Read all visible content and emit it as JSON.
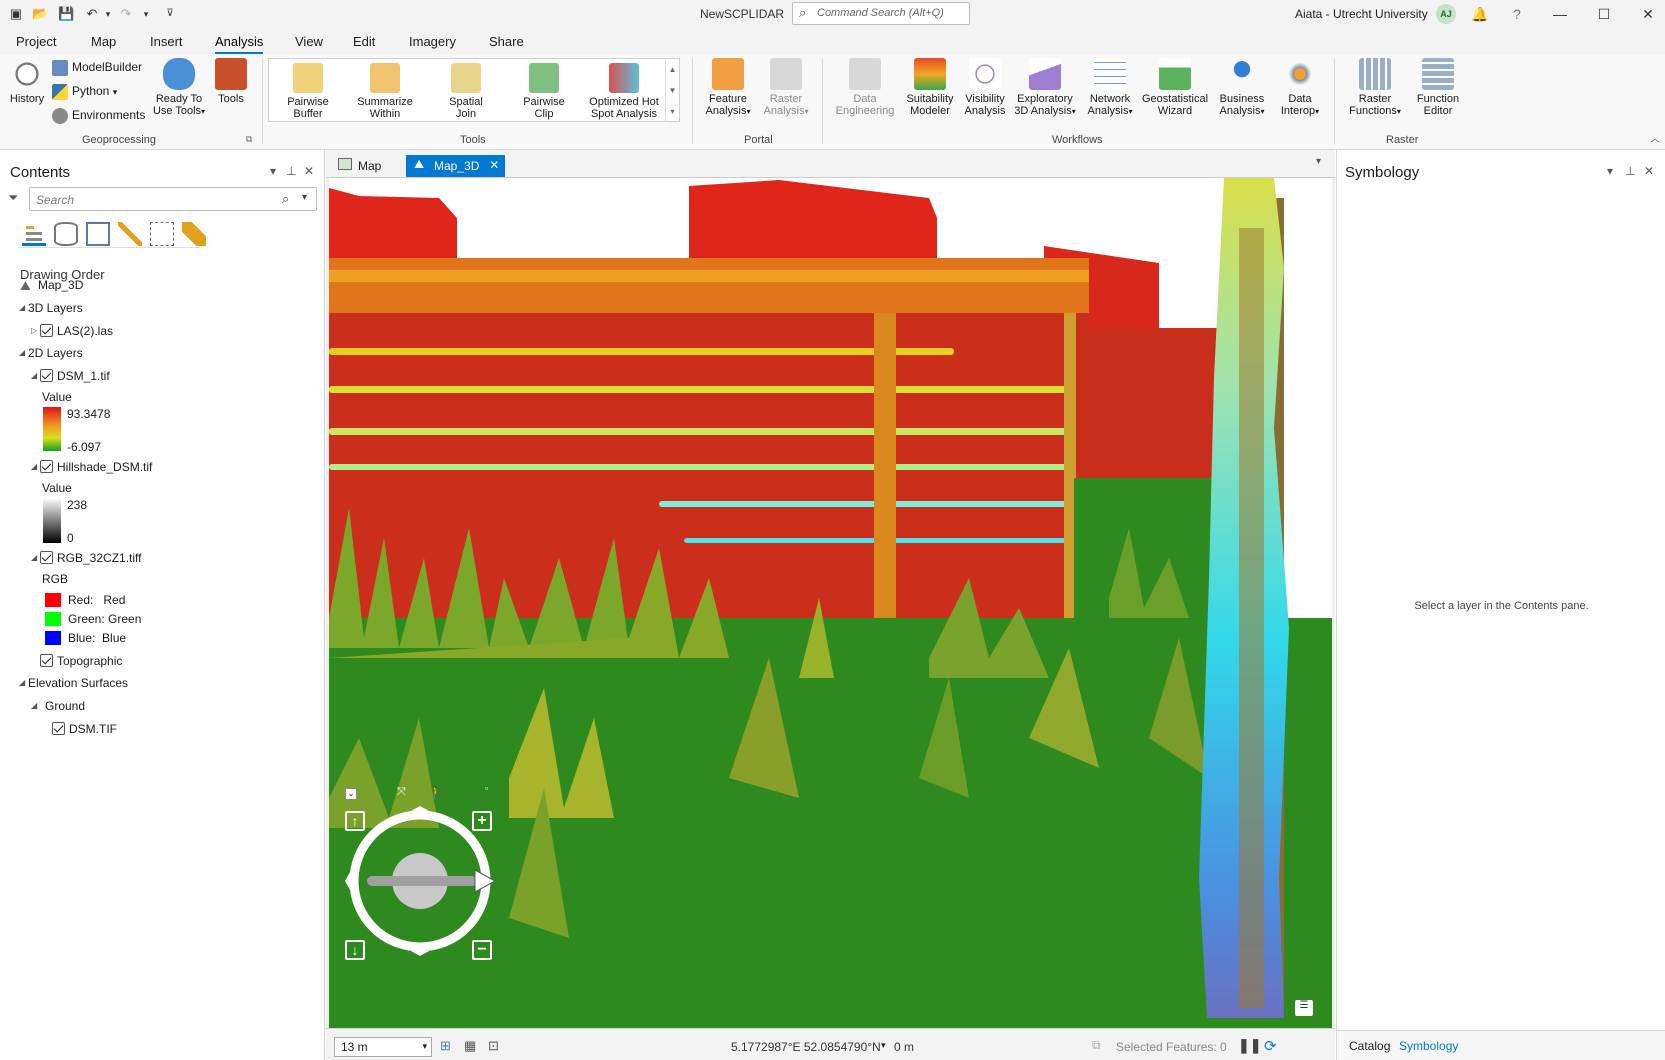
{
  "titlebar": {
    "app_title": "NewSCPLIDAR",
    "command_search_placeholder": "Command Search (Alt+Q)",
    "user": "Aiata - Utrecht University",
    "avatar_initials": "AJ",
    "help": "?"
  },
  "menu": {
    "tabs": [
      "Project",
      "Map",
      "Insert",
      "Analysis",
      "View",
      "Edit",
      "Imagery",
      "Share"
    ],
    "active": "Analysis"
  },
  "ribbon": {
    "geoprocessing": {
      "label": "Geoprocessing",
      "history": "History",
      "modelbuilder": "ModelBuilder",
      "python": "Python",
      "environments": "Environments",
      "ready_to_use_1": "Ready To",
      "ready_to_use_2": "Use Tools",
      "tools": "Tools"
    },
    "tools": {
      "label": "Tools",
      "items": [
        {
          "l1": "Pairwise",
          "l2": "Buffer"
        },
        {
          "l1": "Summarize",
          "l2": "Within"
        },
        {
          "l1": "Spatial",
          "l2": "Join"
        },
        {
          "l1": "Pairwise",
          "l2": "Clip"
        },
        {
          "l1": "Optimized Hot",
          "l2": "Spot Analysis"
        }
      ]
    },
    "portal": {
      "label": "Portal",
      "feature_1": "Feature",
      "feature_2": "Analysis",
      "raster_1": "Raster",
      "raster_2": "Analysis"
    },
    "workflows": {
      "label": "Workflows",
      "items": [
        {
          "l1": "Data",
          "l2": "Engineering",
          "disabled": true
        },
        {
          "l1": "Suitability",
          "l2": "Modeler"
        },
        {
          "l1": "Visibility",
          "l2": "Analysis"
        },
        {
          "l1": "Exploratory",
          "l2": "3D Analysis"
        },
        {
          "l1": "Network",
          "l2": "Analysis"
        },
        {
          "l1": "Geostatistical",
          "l2": "Wizard"
        },
        {
          "l1": "Business",
          "l2": "Analysis"
        },
        {
          "l1": "Data",
          "l2": "Interop"
        }
      ]
    },
    "raster": {
      "label": "Raster",
      "rf_1": "Raster",
      "rf_2": "Functions",
      "fe_1": "Function",
      "fe_2": "Editor"
    }
  },
  "contents": {
    "title": "Contents",
    "search_placeholder": "Search",
    "drawing_order": "Drawing Order",
    "map": "Map_3D",
    "layers_3d": "3D Layers",
    "las": "LAS(2).las",
    "layers_2d": "2D Layers",
    "dsm": "DSM_1.tif",
    "value_label": "Value",
    "dsm_max": "93.3478",
    "dsm_min": "-6.097",
    "hillshade": "Hillshade_DSM.tif",
    "hs_max": "238",
    "hs_min": "0",
    "rgb": "RGB_32CZ1.tiff",
    "rgb_label": "RGB",
    "red": "Red:   Red",
    "green": "Green: Green",
    "blue": "Blue:  Blue",
    "topographic": "Topographic",
    "elevation_surfaces": "Elevation Surfaces",
    "ground": "Ground",
    "dsm_tif": "DSM.TIF"
  },
  "map_tabs": [
    {
      "label": "Map",
      "active": false
    },
    {
      "label": "Map_3D",
      "active": true
    }
  ],
  "status": {
    "scale": "13 m",
    "coords": "5.1772987°E 52.0854790°N",
    "elevation": "0 m",
    "selected": "Selected Features: 0"
  },
  "symbology": {
    "title": "Symbology",
    "message": "Select a layer in the Contents pane."
  },
  "right_tabs": [
    "Catalog",
    "Symbology"
  ],
  "colors": {
    "accent": "#0078d4",
    "building": "#d4301a",
    "grass": "#2e8a1f"
  }
}
